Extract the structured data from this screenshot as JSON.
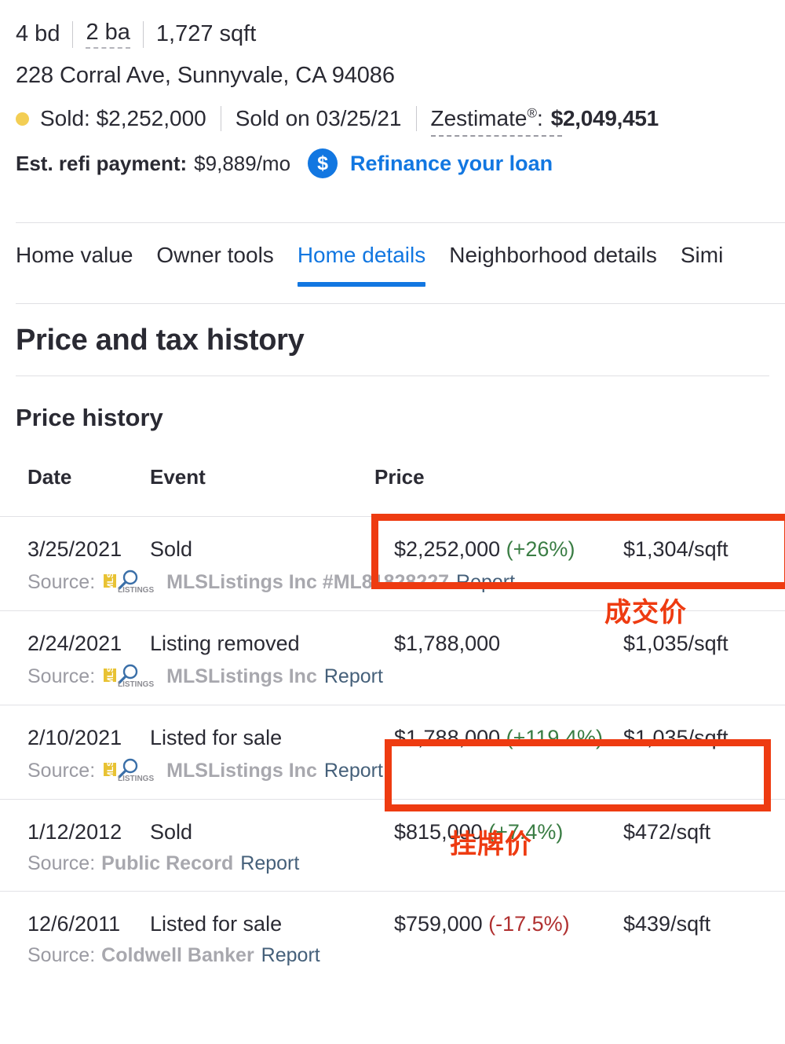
{
  "property": {
    "facts": [
      {
        "text": "4 bd",
        "dashed": false
      },
      {
        "text": "2 ba",
        "dashed": true
      },
      {
        "text": "1,727 sqft",
        "dashed": false
      }
    ],
    "address": "228 Corral Ave, Sunnyvale, CA 94086",
    "status": {
      "sold_label": "Sold: $2,252,000",
      "sold_on": "Sold on 03/25/21",
      "zestimate_label": "Zestimate",
      "zestimate_sup": "®",
      "zestimate_colon": ":",
      "zestimate_value": "$2,049,451",
      "dot_color": "#f3ce54"
    },
    "refi": {
      "label": "Est. refi payment:",
      "amount": "$9,889/mo",
      "icon": "dollar-circle-icon",
      "icon_glyph": "$",
      "link": "Refinance your loan",
      "link_color": "#1277e1"
    }
  },
  "tabs": {
    "items": [
      {
        "label": "Home value",
        "active": false
      },
      {
        "label": "Owner tools",
        "active": false
      },
      {
        "label": "Home details",
        "active": true
      },
      {
        "label": "Neighborhood details",
        "active": false
      },
      {
        "label": "Simi",
        "active": false
      }
    ],
    "active_color": "#1277e1"
  },
  "section": {
    "title": "Price and tax history",
    "subtitle": "Price history"
  },
  "price_history": {
    "columns": [
      "Date",
      "Event",
      "Price"
    ],
    "rows": [
      {
        "date": "3/25/2021",
        "event": "Sold",
        "price": "$2,252,000",
        "change": "(+26%)",
        "change_dir": "up",
        "ppsf": "$1,304/sqft",
        "source_label": "Source:",
        "source_logo": "mlslistings-logo-icon",
        "source_name": "MLSListings Inc #ML81828227",
        "report": "Report"
      },
      {
        "date": "2/24/2021",
        "event": "Listing removed",
        "price": "$1,788,000",
        "change": "",
        "change_dir": "none",
        "ppsf": "$1,035/sqft",
        "source_label": "Source:",
        "source_logo": "mlslistings-logo-icon",
        "source_name": "MLSListings Inc",
        "report": "Report"
      },
      {
        "date": "2/10/2021",
        "event": "Listed for sale",
        "price": "$1,788,000",
        "change": "(+119.4%)",
        "change_dir": "up",
        "ppsf": "$1,035/sqft",
        "source_label": "Source:",
        "source_logo": "mlslistings-logo-icon",
        "source_name": "MLSListings Inc",
        "report": "Report"
      },
      {
        "date": "1/12/2012",
        "event": "Sold",
        "price": "$815,000",
        "change": "(+7.4%)",
        "change_dir": "up",
        "ppsf": "$472/sqft",
        "source_label": "Source:",
        "source_logo": "",
        "source_name": "Public Record",
        "report": "Report"
      },
      {
        "date": "12/6/2011",
        "event": "Listed for sale",
        "price": "$759,000",
        "change": "(-17.5%)",
        "change_dir": "down",
        "ppsf": "$439/sqft",
        "source_label": "Source:",
        "source_logo": "",
        "source_name": "Coldwell Banker",
        "report": "Report"
      }
    ]
  },
  "annotations": {
    "color": "#ee3b11",
    "sold_label": "成交价",
    "listed_label": "挂牌价"
  }
}
